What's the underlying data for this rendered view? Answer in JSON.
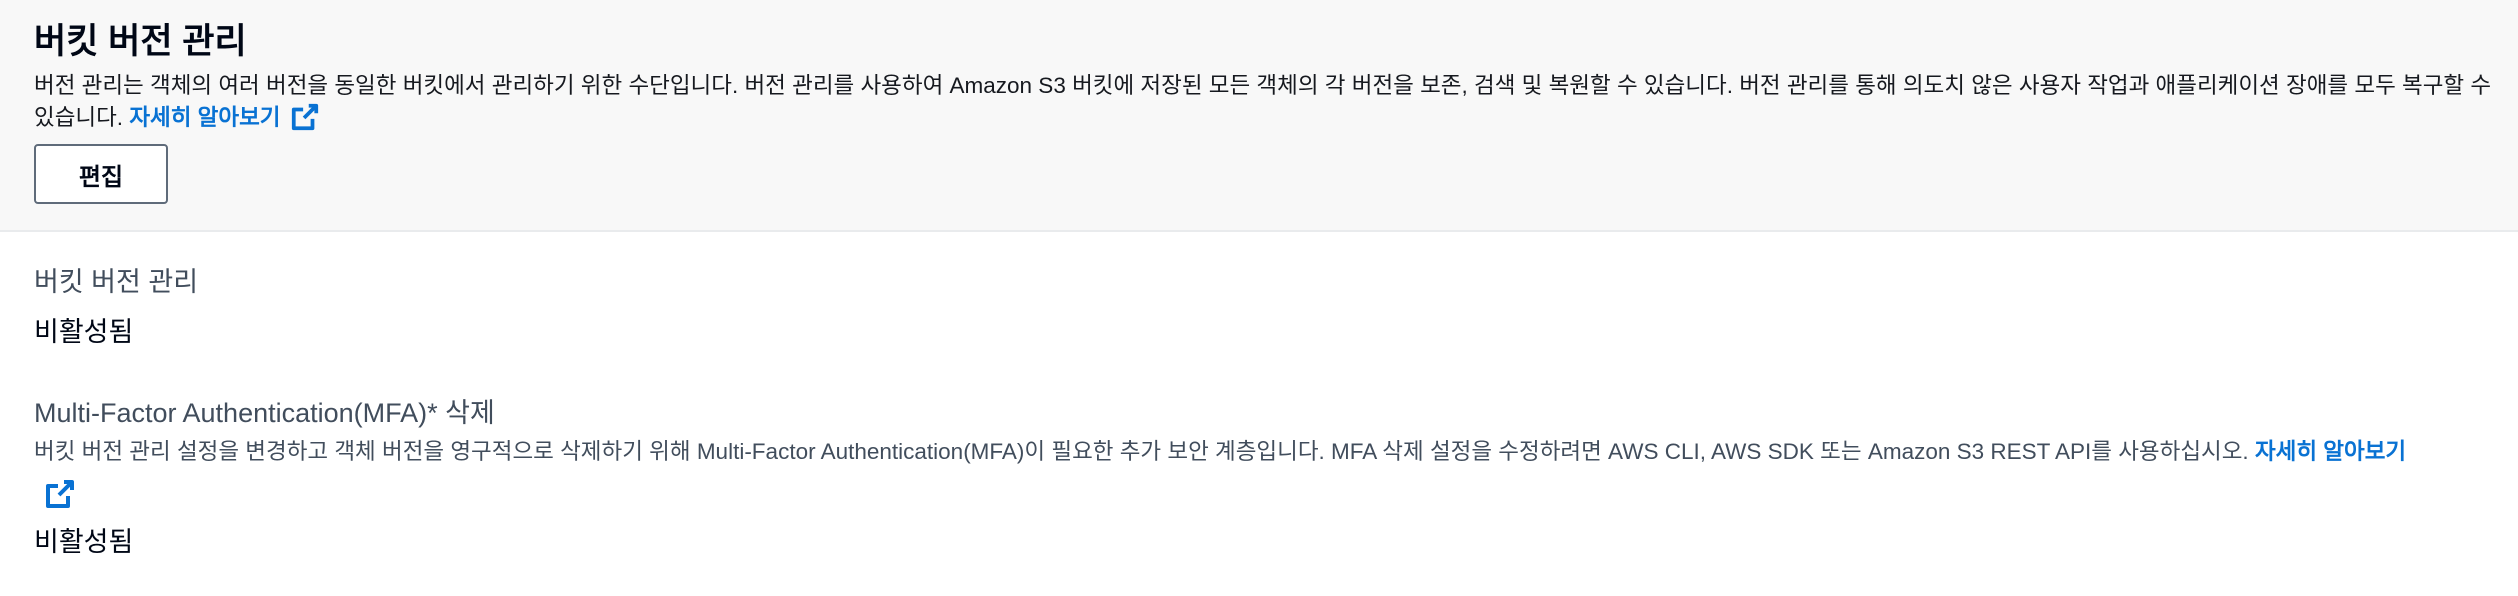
{
  "header": {
    "title": "버킷 버전 관리",
    "description": "버전 관리는 객체의 여러 버전을 동일한 버킷에서 관리하기 위한 수단입니다. 버전 관리를 사용하여 Amazon S3 버킷에 저장된 모든 객체의 각 버전을 보존, 검색 및 복원할 수 있습니다. 버전 관리를 통해 의도치 않은 사용자 작업과 애플리케이션 장애를 모두 복구할 수 있습니다.",
    "learn_more_label": "자세히 알아보기",
    "edit_label": "편집"
  },
  "versioning": {
    "label": "버킷 버전 관리",
    "value": "비활성됨"
  },
  "mfa_delete": {
    "label": "Multi-Factor Authentication(MFA)* 삭제",
    "description": "버킷 버전 관리 설정을 변경하고 객체 버전을 영구적으로 삭제하기 위해 Multi-Factor Authentication(MFA)이 필요한 추가 보안 계층입니다. MFA 삭제 설정을 수정하려면 AWS CLI, AWS SDK 또는 Amazon S3 REST API를 사용하십시오.",
    "learn_more_label": "자세히 알아보기",
    "value": "비활성됨"
  },
  "icons": {
    "external_link": "external-link-icon"
  },
  "colors": {
    "link": "#0972d3",
    "header_bg": "#f8f8f8",
    "text_primary": "#000716",
    "text_secondary": "#414d5c",
    "button_border": "#5f6b7a"
  }
}
